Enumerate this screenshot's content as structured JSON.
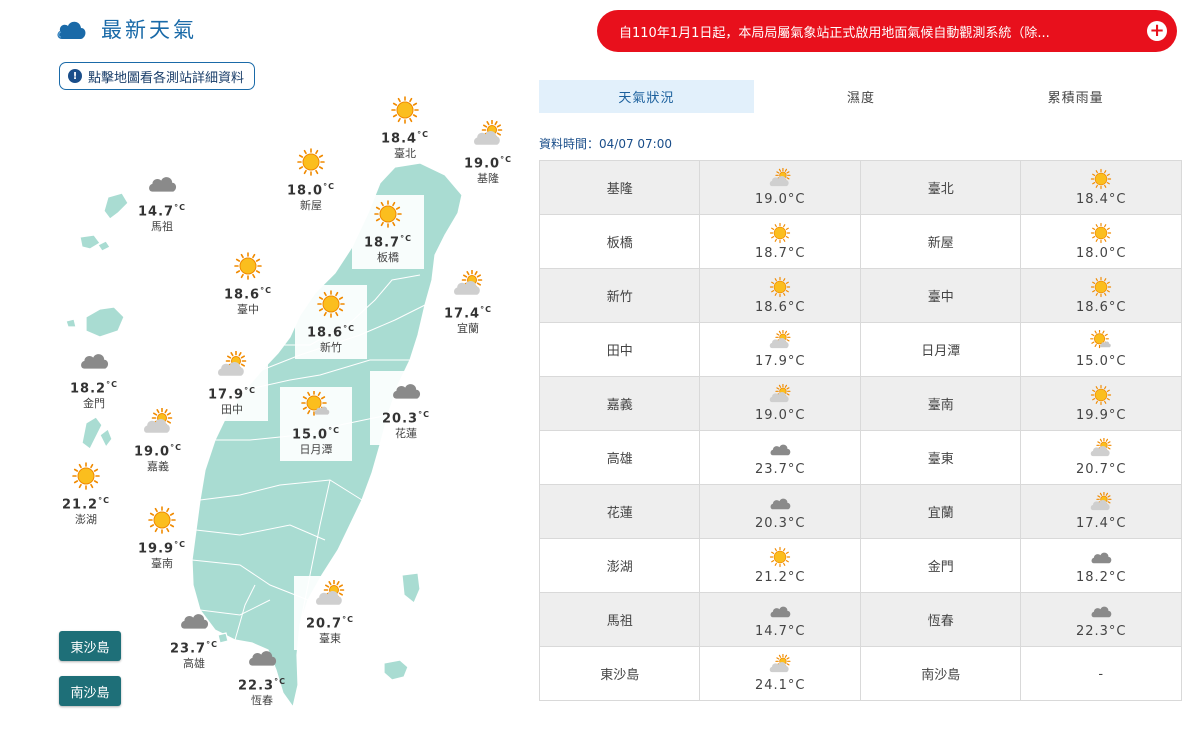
{
  "header": {
    "title": "最新天氣"
  },
  "map_hint": {
    "label": "點擊地圖看各測站詳細資料"
  },
  "alert": {
    "text": "自110年1月1日起，本局局屬氣象站正式啟用地面氣候自動觀測系統（除..."
  },
  "tabs": [
    {
      "label": "天氣狀況",
      "active": true
    },
    {
      "label": "濕度",
      "active": false
    },
    {
      "label": "累積雨量",
      "active": false
    }
  ],
  "data_time": "資料時間：04/07 07:00",
  "unit": "°C",
  "colors": {
    "accent": "#1a6aa8",
    "alert": "#e8101c",
    "land": "#a9dcd2",
    "island_button": "#1e6f78",
    "tab_active": "#e2f0fb"
  },
  "map_stations": [
    {
      "name": "臺北",
      "temp": "18.4",
      "icon": "sunny"
    },
    {
      "name": "基隆",
      "temp": "19.0",
      "icon": "partly-cloudy"
    },
    {
      "name": "新屋",
      "temp": "18.0",
      "icon": "sunny"
    },
    {
      "name": "板橋",
      "temp": "18.7",
      "icon": "sunny"
    },
    {
      "name": "馬祖",
      "temp": "14.7",
      "icon": "cloudy"
    },
    {
      "name": "臺中",
      "temp": "18.6",
      "icon": "sunny"
    },
    {
      "name": "新竹",
      "temp": "18.6",
      "icon": "sunny"
    },
    {
      "name": "宜蘭",
      "temp": "17.4",
      "icon": "partly-cloudy"
    },
    {
      "name": "金門",
      "temp": "18.2",
      "icon": "cloudy"
    },
    {
      "name": "田中",
      "temp": "17.9",
      "icon": "partly-cloudy"
    },
    {
      "name": "花蓮",
      "temp": "20.3",
      "icon": "cloudy"
    },
    {
      "name": "日月潭",
      "temp": "15.0",
      "icon": "sunny-cloud"
    },
    {
      "name": "嘉義",
      "temp": "19.0",
      "icon": "partly-cloudy"
    },
    {
      "name": "澎湖",
      "temp": "21.2",
      "icon": "sunny"
    },
    {
      "name": "臺南",
      "temp": "19.9",
      "icon": "sunny"
    },
    {
      "name": "臺東",
      "temp": "20.7",
      "icon": "partly-cloudy"
    },
    {
      "name": "高雄",
      "temp": "23.7",
      "icon": "cloudy"
    },
    {
      "name": "恆春",
      "temp": "22.3",
      "icon": "cloudy"
    }
  ],
  "island_buttons": [
    {
      "label": "東沙島"
    },
    {
      "label": "南沙島"
    }
  ],
  "table": [
    [
      {
        "name": "基隆",
        "temp": "19.0°C",
        "icon": "partly-cloudy"
      },
      {
        "name": "臺北",
        "temp": "18.4°C",
        "icon": "sunny"
      }
    ],
    [
      {
        "name": "板橋",
        "temp": "18.7°C",
        "icon": "sunny"
      },
      {
        "name": "新屋",
        "temp": "18.0°C",
        "icon": "sunny"
      }
    ],
    [
      {
        "name": "新竹",
        "temp": "18.6°C",
        "icon": "sunny"
      },
      {
        "name": "臺中",
        "temp": "18.6°C",
        "icon": "sunny"
      }
    ],
    [
      {
        "name": "田中",
        "temp": "17.9°C",
        "icon": "partly-cloudy"
      },
      {
        "name": "日月潭",
        "temp": "15.0°C",
        "icon": "sunny-cloud"
      }
    ],
    [
      {
        "name": "嘉義",
        "temp": "19.0°C",
        "icon": "partly-cloudy"
      },
      {
        "name": "臺南",
        "temp": "19.9°C",
        "icon": "sunny"
      }
    ],
    [
      {
        "name": "高雄",
        "temp": "23.7°C",
        "icon": "cloudy"
      },
      {
        "name": "臺東",
        "temp": "20.7°C",
        "icon": "partly-cloudy"
      }
    ],
    [
      {
        "name": "花蓮",
        "temp": "20.3°C",
        "icon": "cloudy"
      },
      {
        "name": "宜蘭",
        "temp": "17.4°C",
        "icon": "partly-cloudy"
      }
    ],
    [
      {
        "name": "澎湖",
        "temp": "21.2°C",
        "icon": "sunny"
      },
      {
        "name": "金門",
        "temp": "18.2°C",
        "icon": "cloudy"
      }
    ],
    [
      {
        "name": "馬祖",
        "temp": "14.7°C",
        "icon": "cloudy"
      },
      {
        "name": "恆春",
        "temp": "22.3°C",
        "icon": "cloudy"
      }
    ],
    [
      {
        "name": "東沙島",
        "temp": "24.1°C",
        "icon": "partly-cloudy"
      },
      {
        "name": "南沙島",
        "temp": "-",
        "icon": "none"
      }
    ]
  ]
}
